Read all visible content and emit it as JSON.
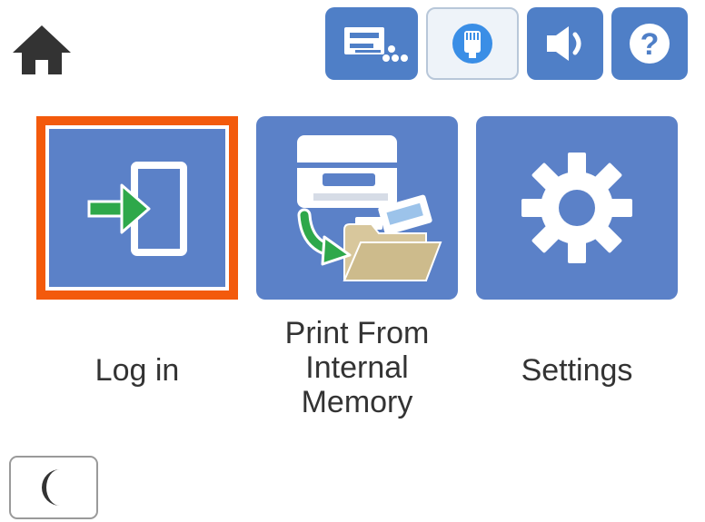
{
  "top_bar": {
    "home_icon": "home-icon",
    "status_icons": [
      {
        "name": "printer-ink-icon"
      },
      {
        "name": "wired-lan-icon",
        "selected": true
      },
      {
        "name": "volume-icon"
      },
      {
        "name": "help-icon",
        "glyph": "?"
      }
    ]
  },
  "tiles": [
    {
      "id": "login",
      "label": "Log in",
      "icon": "login-icon"
    },
    {
      "id": "print",
      "label": "Print From Internal Memory",
      "icon": "print-from-memory-icon"
    },
    {
      "id": "settings",
      "label": "Settings",
      "icon": "gear-icon"
    }
  ],
  "sleep": {
    "icon": "moon-icon"
  },
  "colors": {
    "tile_blue": "#5b81c8",
    "status_blue": "#4f7fc7",
    "focus_orange": "#f35a0c",
    "arrow_green": "#2ea84a",
    "folder_tan": "#d8c79c"
  }
}
